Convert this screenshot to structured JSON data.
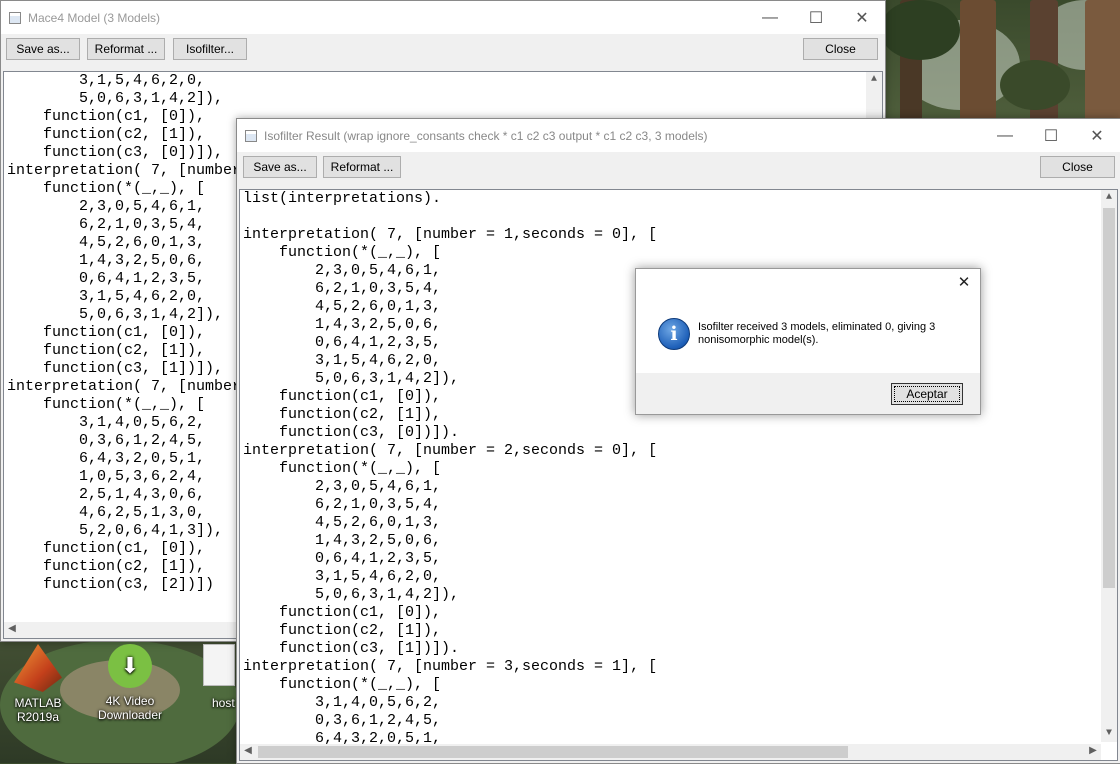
{
  "mace4_window": {
    "title": "Mace4 Model (3 Models)",
    "buttons": {
      "save": "Save as...",
      "reformat": "Reformat ...",
      "isofilter": "Isofilter...",
      "close": "Close"
    },
    "text": "        3,1,5,4,6,2,0,\n        5,0,6,3,1,4,2]),\n    function(c1, [0]),\n    function(c2, [1]),\n    function(c3, [0])]),\ninterpretation( 7, [number = 2,seconds = 0], [\n    function(*(_,_), [\n        2,3,0,5,4,6,1,\n        6,2,1,0,3,5,4,\n        4,5,2,6,0,1,3,\n        1,4,3,2,5,0,6,\n        0,6,4,1,2,3,5,\n        3,1,5,4,6,2,0,\n        5,0,6,3,1,4,2]),\n    function(c1, [0]),\n    function(c2, [1]),\n    function(c3, [1])]),\ninterpretation( 7, [number = 3,seconds = 1], [\n    function(*(_,_), [\n        3,1,4,0,5,6,2,\n        0,3,6,1,2,4,5,\n        6,4,3,2,0,5,1,\n        1,0,5,3,6,2,4,\n        2,5,1,4,3,0,6,\n        4,6,2,5,1,3,0,\n        5,2,0,6,4,1,3]),\n    function(c1, [0]),\n    function(c2, [1]),\n    function(c3, [2])])"
  },
  "isofilter_window": {
    "title": "Isofilter Result (wrap ignore_consants check * c1 c2 c3 output * c1 c2 c3, 3 models)",
    "buttons": {
      "save": "Save as...",
      "reformat": "Reformat ...",
      "close": "Close"
    },
    "text": "list(interpretations).\n\ninterpretation( 7, [number = 1,seconds = 0], [\n    function(*(_,_), [\n        2,3,0,5,4,6,1,\n        6,2,1,0,3,5,4,\n        4,5,2,6,0,1,3,\n        1,4,3,2,5,0,6,\n        0,6,4,1,2,3,5,\n        3,1,5,4,6,2,0,\n        5,0,6,3,1,4,2]),\n    function(c1, [0]),\n    function(c2, [1]),\n    function(c3, [0])]).\ninterpretation( 7, [number = 2,seconds = 0], [\n    function(*(_,_), [\n        2,3,0,5,4,6,1,\n        6,2,1,0,3,5,4,\n        4,5,2,6,0,1,3,\n        1,4,3,2,5,0,6,\n        0,6,4,1,2,3,5,\n        3,1,5,4,6,2,0,\n        5,0,6,3,1,4,2]),\n    function(c1, [0]),\n    function(c2, [1]),\n    function(c3, [1])]).\ninterpretation( 7, [number = 3,seconds = 1], [\n    function(*(_,_), [\n        3,1,4,0,5,6,2,\n        0,3,6,1,2,4,5,\n        6,4,3,2,0,5,1,"
  },
  "dialog": {
    "message": "Isofilter received 3 models, eliminated 0, giving 3 nonisomorphic model(s).",
    "ok_label": "Aceptar"
  },
  "desktop_icons": [
    {
      "label": "MATLAB R2019a",
      "icon": "matlab-icon"
    },
    {
      "label": "4K Video Downloader",
      "icon": "4k-video-downloader-icon"
    },
    {
      "label": "host",
      "icon": "file-icon"
    }
  ],
  "window_controls": {
    "minimize": "—",
    "maximize": "☐",
    "close": "✕"
  }
}
